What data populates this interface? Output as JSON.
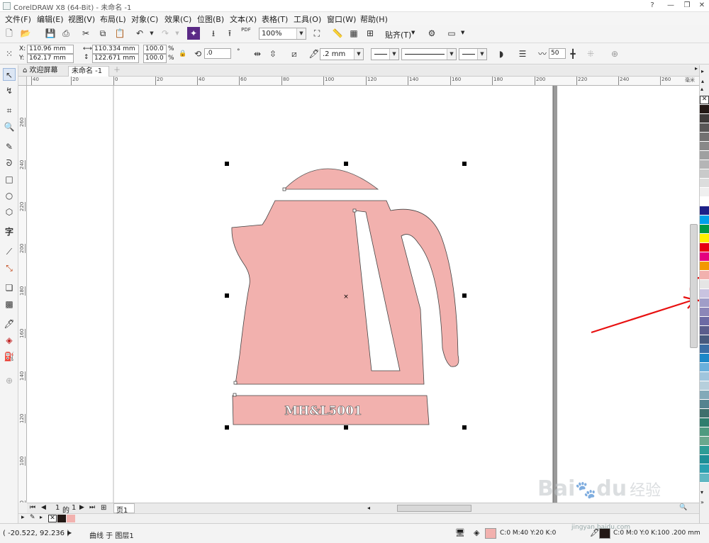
{
  "window": {
    "title": "CorelDRAW X8 (64-Bit) - 未命名 -1",
    "controls": [
      "?",
      "—",
      "❐",
      "✕"
    ]
  },
  "menu": [
    "文件(F)",
    "编辑(E)",
    "视图(V)",
    "布局(L)",
    "对象(C)",
    "效果(C)",
    "位图(B)",
    "文本(X)",
    "表格(T)",
    "工具(O)",
    "窗口(W)",
    "帮助(H)"
  ],
  "toolbar": {
    "zoom": "100%",
    "snap_label": "贴齐(T)",
    "pdf_label": "PDF"
  },
  "property_bar": {
    "x_label": "X:",
    "x_value": "110.96 mm",
    "y_label": "Y:",
    "y_value": "162.17 mm",
    "width_value": "110.334 mm",
    "height_value": "122.671 mm",
    "scale_x": "100.0",
    "scale_y": "100.0",
    "percent": "%",
    "rotation": ".0",
    "degree": "°",
    "outline_width": ".2 mm",
    "smoothing": "50"
  },
  "tabs": {
    "welcome": "欢迎屏幕",
    "document": "未命名 -1"
  },
  "ruler": {
    "h_ticks": [
      "40",
      "20",
      "0",
      "20",
      "40",
      "60",
      "80",
      "100",
      "120",
      "140",
      "160",
      "180",
      "200",
      "220",
      "240",
      "260"
    ],
    "h_unit": "毫米",
    "v_ticks": [
      "260",
      "240",
      "220",
      "200",
      "180",
      "160",
      "140",
      "120",
      "100",
      "80"
    ]
  },
  "page_nav": {
    "current": "1",
    "of": "的",
    "total": "1",
    "page_tab": "页1"
  },
  "artwork": {
    "kettle_fill": "#f2b1ae",
    "kettle_text": "MH&L5001"
  },
  "status": {
    "coords": "( -20.522, 92.236 )",
    "object_info": "曲线 于 图层1",
    "fill_info": "C:0 M:40 Y:20 K:0",
    "fill_color": "#f2b1ae",
    "outline_info": "C:0 M:0 Y:0 K:100  .200 mm",
    "outline_color": "#231815"
  },
  "watermark": {
    "brand": "Bai",
    "brand2": "du",
    "cn": "经验",
    "url": "jingyan.baidu.com"
  },
  "palette": {
    "colors": [
      "#231815",
      "#3e3a39",
      "#595757",
      "#727171",
      "#898989",
      "#9fa0a0",
      "#b5b5b6",
      "#c9caca",
      "#dcdddd",
      "#efefef",
      "#ffffff",
      "#1d2088",
      "#00a0e9",
      "#009944",
      "#fff100",
      "#e60012",
      "#e4007f",
      "#f39800",
      "#f2b1ae",
      "#e5e5e5",
      "#c9c3e0",
      "#a09dc8",
      "#8b86b8",
      "#6c6aa4",
      "#5a5d8c",
      "#475a7e",
      "#3a6ea5",
      "#1d88c8",
      "#6ab0dc",
      "#9fc5dd",
      "#b6cfdc",
      "#83a9b8",
      "#55838f",
      "#3f6f6c",
      "#2e7d6d",
      "#4e9a80",
      "#6aa88e",
      "#2e9c96",
      "#1e8f97",
      "#2aa0b0",
      "#5fb7c2"
    ]
  },
  "annotation": {
    "color": "#e81010"
  }
}
